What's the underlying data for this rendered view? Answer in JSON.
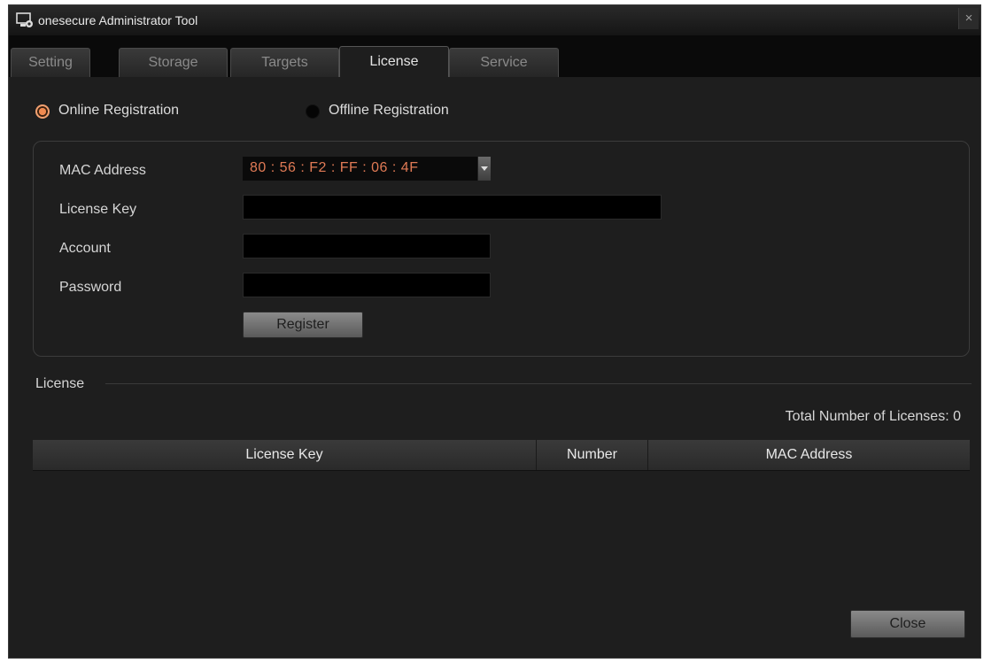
{
  "window": {
    "title": "onesecure Administrator Tool",
    "close_glyph": "×"
  },
  "tabs": [
    {
      "label": "Setting",
      "active": false
    },
    {
      "label": "Storage",
      "active": false
    },
    {
      "label": "Targets",
      "active": false
    },
    {
      "label": "License",
      "active": true
    },
    {
      "label": "Service",
      "active": false
    }
  ],
  "registration": {
    "online_label": "Online Registration",
    "offline_label": "Offline Registration",
    "selected": "online"
  },
  "form": {
    "mac_label": "MAC Address",
    "mac_value": "80 : 56 : F2 : FF : 06 : 4F",
    "license_key_label": "License Key",
    "license_key_value": "",
    "account_label": "Account",
    "account_value": "",
    "password_label": "Password",
    "password_value": "",
    "register_button": "Register"
  },
  "license_section": {
    "title": "License",
    "total_text": "Total Number of Licenses: 0",
    "columns": [
      "License Key",
      "Number",
      "MAC Address"
    ],
    "rows": []
  },
  "footer": {
    "close_button": "Close"
  },
  "colors": {
    "accent_radio": "#e07840",
    "mac_text": "#e07a55",
    "window_bg": "#1e1e1e"
  },
  "icons": {
    "app": "monitor-gear-icon",
    "dropdown": "chevron-down-icon"
  }
}
